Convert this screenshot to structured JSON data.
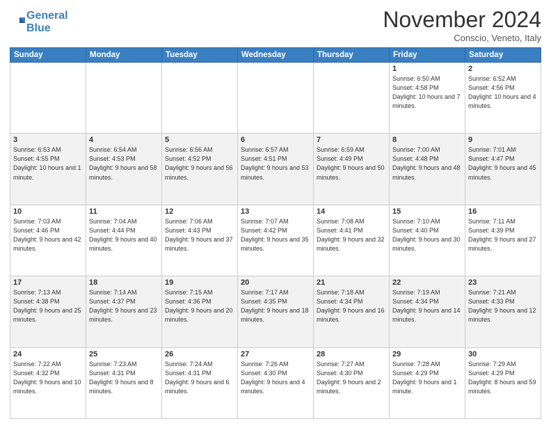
{
  "header": {
    "logo_line1": "General",
    "logo_line2": "Blue",
    "month": "November 2024",
    "location": "Conscio, Veneto, Italy"
  },
  "weekdays": [
    "Sunday",
    "Monday",
    "Tuesday",
    "Wednesday",
    "Thursday",
    "Friday",
    "Saturday"
  ],
  "weeks": [
    [
      {
        "day": "",
        "info": ""
      },
      {
        "day": "",
        "info": ""
      },
      {
        "day": "",
        "info": ""
      },
      {
        "day": "",
        "info": ""
      },
      {
        "day": "",
        "info": ""
      },
      {
        "day": "1",
        "info": "Sunrise: 6:50 AM\nSunset: 4:58 PM\nDaylight: 10 hours\nand 7 minutes."
      },
      {
        "day": "2",
        "info": "Sunrise: 6:52 AM\nSunset: 4:56 PM\nDaylight: 10 hours\nand 4 minutes."
      }
    ],
    [
      {
        "day": "3",
        "info": "Sunrise: 6:53 AM\nSunset: 4:55 PM\nDaylight: 10 hours\nand 1 minute."
      },
      {
        "day": "4",
        "info": "Sunrise: 6:54 AM\nSunset: 4:53 PM\nDaylight: 9 hours\nand 58 minutes."
      },
      {
        "day": "5",
        "info": "Sunrise: 6:56 AM\nSunset: 4:52 PM\nDaylight: 9 hours\nand 56 minutes."
      },
      {
        "day": "6",
        "info": "Sunrise: 6:57 AM\nSunset: 4:51 PM\nDaylight: 9 hours\nand 53 minutes."
      },
      {
        "day": "7",
        "info": "Sunrise: 6:59 AM\nSunset: 4:49 PM\nDaylight: 9 hours\nand 50 minutes."
      },
      {
        "day": "8",
        "info": "Sunrise: 7:00 AM\nSunset: 4:48 PM\nDaylight: 9 hours\nand 48 minutes."
      },
      {
        "day": "9",
        "info": "Sunrise: 7:01 AM\nSunset: 4:47 PM\nDaylight: 9 hours\nand 45 minutes."
      }
    ],
    [
      {
        "day": "10",
        "info": "Sunrise: 7:03 AM\nSunset: 4:46 PM\nDaylight: 9 hours\nand 42 minutes."
      },
      {
        "day": "11",
        "info": "Sunrise: 7:04 AM\nSunset: 4:44 PM\nDaylight: 9 hours\nand 40 minutes."
      },
      {
        "day": "12",
        "info": "Sunrise: 7:06 AM\nSunset: 4:43 PM\nDaylight: 9 hours\nand 37 minutes."
      },
      {
        "day": "13",
        "info": "Sunrise: 7:07 AM\nSunset: 4:42 PM\nDaylight: 9 hours\nand 35 minutes."
      },
      {
        "day": "14",
        "info": "Sunrise: 7:08 AM\nSunset: 4:41 PM\nDaylight: 9 hours\nand 32 minutes."
      },
      {
        "day": "15",
        "info": "Sunrise: 7:10 AM\nSunset: 4:40 PM\nDaylight: 9 hours\nand 30 minutes."
      },
      {
        "day": "16",
        "info": "Sunrise: 7:11 AM\nSunset: 4:39 PM\nDaylight: 9 hours\nand 27 minutes."
      }
    ],
    [
      {
        "day": "17",
        "info": "Sunrise: 7:13 AM\nSunset: 4:38 PM\nDaylight: 9 hours\nand 25 minutes."
      },
      {
        "day": "18",
        "info": "Sunrise: 7:14 AM\nSunset: 4:37 PM\nDaylight: 9 hours\nand 23 minutes."
      },
      {
        "day": "19",
        "info": "Sunrise: 7:15 AM\nSunset: 4:36 PM\nDaylight: 9 hours\nand 20 minutes."
      },
      {
        "day": "20",
        "info": "Sunrise: 7:17 AM\nSunset: 4:35 PM\nDaylight: 9 hours\nand 18 minutes."
      },
      {
        "day": "21",
        "info": "Sunrise: 7:18 AM\nSunset: 4:34 PM\nDaylight: 9 hours\nand 16 minutes."
      },
      {
        "day": "22",
        "info": "Sunrise: 7:19 AM\nSunset: 4:34 PM\nDaylight: 9 hours\nand 14 minutes."
      },
      {
        "day": "23",
        "info": "Sunrise: 7:21 AM\nSunset: 4:33 PM\nDaylight: 9 hours\nand 12 minutes."
      }
    ],
    [
      {
        "day": "24",
        "info": "Sunrise: 7:22 AM\nSunset: 4:32 PM\nDaylight: 9 hours\nand 10 minutes."
      },
      {
        "day": "25",
        "info": "Sunrise: 7:23 AM\nSunset: 4:31 PM\nDaylight: 9 hours\nand 8 minutes."
      },
      {
        "day": "26",
        "info": "Sunrise: 7:24 AM\nSunset: 4:31 PM\nDaylight: 9 hours\nand 6 minutes."
      },
      {
        "day": "27",
        "info": "Sunrise: 7:26 AM\nSunset: 4:30 PM\nDaylight: 9 hours\nand 4 minutes."
      },
      {
        "day": "28",
        "info": "Sunrise: 7:27 AM\nSunset: 4:30 PM\nDaylight: 9 hours\nand 2 minutes."
      },
      {
        "day": "29",
        "info": "Sunrise: 7:28 AM\nSunset: 4:29 PM\nDaylight: 9 hours\nand 1 minute."
      },
      {
        "day": "30",
        "info": "Sunrise: 7:29 AM\nSunset: 4:29 PM\nDaylight: 8 hours\nand 59 minutes."
      }
    ]
  ]
}
